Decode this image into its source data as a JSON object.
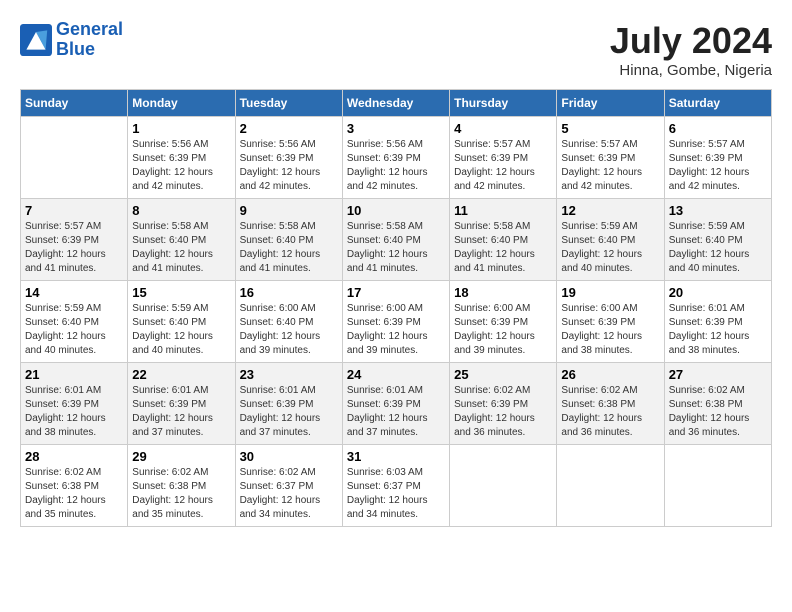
{
  "header": {
    "logo_line1": "General",
    "logo_line2": "Blue",
    "month_year": "July 2024",
    "location": "Hinna, Gombe, Nigeria"
  },
  "days_of_week": [
    "Sunday",
    "Monday",
    "Tuesday",
    "Wednesday",
    "Thursday",
    "Friday",
    "Saturday"
  ],
  "weeks": [
    [
      {
        "day": "",
        "info": ""
      },
      {
        "day": "1",
        "info": "Sunrise: 5:56 AM\nSunset: 6:39 PM\nDaylight: 12 hours\nand 42 minutes."
      },
      {
        "day": "2",
        "info": "Sunrise: 5:56 AM\nSunset: 6:39 PM\nDaylight: 12 hours\nand 42 minutes."
      },
      {
        "day": "3",
        "info": "Sunrise: 5:56 AM\nSunset: 6:39 PM\nDaylight: 12 hours\nand 42 minutes."
      },
      {
        "day": "4",
        "info": "Sunrise: 5:57 AM\nSunset: 6:39 PM\nDaylight: 12 hours\nand 42 minutes."
      },
      {
        "day": "5",
        "info": "Sunrise: 5:57 AM\nSunset: 6:39 PM\nDaylight: 12 hours\nand 42 minutes."
      },
      {
        "day": "6",
        "info": "Sunrise: 5:57 AM\nSunset: 6:39 PM\nDaylight: 12 hours\nand 42 minutes."
      }
    ],
    [
      {
        "day": "7",
        "info": "Sunrise: 5:57 AM\nSunset: 6:39 PM\nDaylight: 12 hours\nand 41 minutes."
      },
      {
        "day": "8",
        "info": "Sunrise: 5:58 AM\nSunset: 6:40 PM\nDaylight: 12 hours\nand 41 minutes."
      },
      {
        "day": "9",
        "info": "Sunrise: 5:58 AM\nSunset: 6:40 PM\nDaylight: 12 hours\nand 41 minutes."
      },
      {
        "day": "10",
        "info": "Sunrise: 5:58 AM\nSunset: 6:40 PM\nDaylight: 12 hours\nand 41 minutes."
      },
      {
        "day": "11",
        "info": "Sunrise: 5:58 AM\nSunset: 6:40 PM\nDaylight: 12 hours\nand 41 minutes."
      },
      {
        "day": "12",
        "info": "Sunrise: 5:59 AM\nSunset: 6:40 PM\nDaylight: 12 hours\nand 40 minutes."
      },
      {
        "day": "13",
        "info": "Sunrise: 5:59 AM\nSunset: 6:40 PM\nDaylight: 12 hours\nand 40 minutes."
      }
    ],
    [
      {
        "day": "14",
        "info": "Sunrise: 5:59 AM\nSunset: 6:40 PM\nDaylight: 12 hours\nand 40 minutes."
      },
      {
        "day": "15",
        "info": "Sunrise: 5:59 AM\nSunset: 6:40 PM\nDaylight: 12 hours\nand 40 minutes."
      },
      {
        "day": "16",
        "info": "Sunrise: 6:00 AM\nSunset: 6:40 PM\nDaylight: 12 hours\nand 39 minutes."
      },
      {
        "day": "17",
        "info": "Sunrise: 6:00 AM\nSunset: 6:39 PM\nDaylight: 12 hours\nand 39 minutes."
      },
      {
        "day": "18",
        "info": "Sunrise: 6:00 AM\nSunset: 6:39 PM\nDaylight: 12 hours\nand 39 minutes."
      },
      {
        "day": "19",
        "info": "Sunrise: 6:00 AM\nSunset: 6:39 PM\nDaylight: 12 hours\nand 38 minutes."
      },
      {
        "day": "20",
        "info": "Sunrise: 6:01 AM\nSunset: 6:39 PM\nDaylight: 12 hours\nand 38 minutes."
      }
    ],
    [
      {
        "day": "21",
        "info": "Sunrise: 6:01 AM\nSunset: 6:39 PM\nDaylight: 12 hours\nand 38 minutes."
      },
      {
        "day": "22",
        "info": "Sunrise: 6:01 AM\nSunset: 6:39 PM\nDaylight: 12 hours\nand 37 minutes."
      },
      {
        "day": "23",
        "info": "Sunrise: 6:01 AM\nSunset: 6:39 PM\nDaylight: 12 hours\nand 37 minutes."
      },
      {
        "day": "24",
        "info": "Sunrise: 6:01 AM\nSunset: 6:39 PM\nDaylight: 12 hours\nand 37 minutes."
      },
      {
        "day": "25",
        "info": "Sunrise: 6:02 AM\nSunset: 6:39 PM\nDaylight: 12 hours\nand 36 minutes."
      },
      {
        "day": "26",
        "info": "Sunrise: 6:02 AM\nSunset: 6:38 PM\nDaylight: 12 hours\nand 36 minutes."
      },
      {
        "day": "27",
        "info": "Sunrise: 6:02 AM\nSunset: 6:38 PM\nDaylight: 12 hours\nand 36 minutes."
      }
    ],
    [
      {
        "day": "28",
        "info": "Sunrise: 6:02 AM\nSunset: 6:38 PM\nDaylight: 12 hours\nand 35 minutes."
      },
      {
        "day": "29",
        "info": "Sunrise: 6:02 AM\nSunset: 6:38 PM\nDaylight: 12 hours\nand 35 minutes."
      },
      {
        "day": "30",
        "info": "Sunrise: 6:02 AM\nSunset: 6:37 PM\nDaylight: 12 hours\nand 34 minutes."
      },
      {
        "day": "31",
        "info": "Sunrise: 6:03 AM\nSunset: 6:37 PM\nDaylight: 12 hours\nand 34 minutes."
      },
      {
        "day": "",
        "info": ""
      },
      {
        "day": "",
        "info": ""
      },
      {
        "day": "",
        "info": ""
      }
    ]
  ]
}
